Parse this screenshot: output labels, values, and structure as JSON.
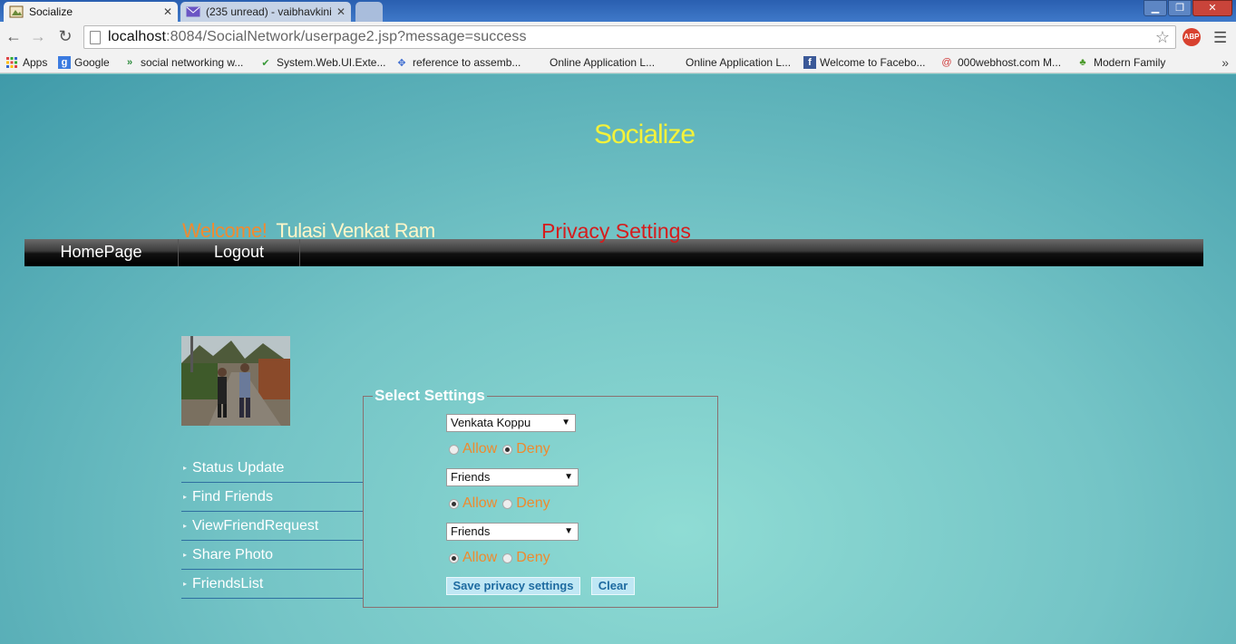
{
  "browser": {
    "tabs": [
      {
        "title": "Socialize",
        "active": true
      },
      {
        "title": "(235 unread) - vaibhavkini",
        "active": false
      }
    ],
    "url": {
      "host": "localhost",
      "rest": ":8084/SocialNetwork/userpage2.jsp?message=success"
    },
    "bookmarks": [
      {
        "label": "Apps",
        "icon": "apps-grid-icon"
      },
      {
        "label": "Google",
        "icon": "google-icon"
      },
      {
        "label": "social networking w...",
        "icon": "chevrons-icon"
      },
      {
        "label": "System.Web.UI.Exte...",
        "icon": "check-icon"
      },
      {
        "label": "reference to assemb...",
        "icon": "dropbox-icon"
      },
      {
        "label": "Online Application L...",
        "icon": ""
      },
      {
        "label": "Online Application L...",
        "icon": ""
      },
      {
        "label": "Welcome to Facebo...",
        "icon": "facebook-icon"
      },
      {
        "label": "000webhost.com M...",
        "icon": "swirl-icon"
      },
      {
        "label": "Modern Family",
        "icon": "tree-icon"
      }
    ],
    "more": "»"
  },
  "site": {
    "title": "Socialize",
    "nav": {
      "home": "HomePage",
      "logout": "Logout"
    },
    "welcome": {
      "greeting": "Welcome!",
      "name": "Tulasi Venkat Ram"
    },
    "page_heading": "Privacy Settings",
    "sidebar": [
      {
        "label": "Status Update"
      },
      {
        "label": "Find Friends"
      },
      {
        "label": "ViewFriendRequest"
      },
      {
        "label": "Share Photo"
      },
      {
        "label": "FriendsList"
      }
    ],
    "settings": {
      "legend": "Select Settings",
      "rows": [
        {
          "selected": "Venkata Koppu",
          "choice": "Deny"
        },
        {
          "selected": "Friends",
          "choice": "Allow"
        },
        {
          "selected": "Friends",
          "choice": "Allow"
        }
      ],
      "allow_label": "Allow",
      "deny_label": "Deny",
      "save_label": "Save privacy settings",
      "clear_label": "Clear"
    }
  },
  "colors": {
    "title": "#f4f23a",
    "welcome": "#f08a30",
    "heading": "#d61c1c",
    "radio_label": "#ee8a2e",
    "button_text": "#1d6aa0"
  }
}
